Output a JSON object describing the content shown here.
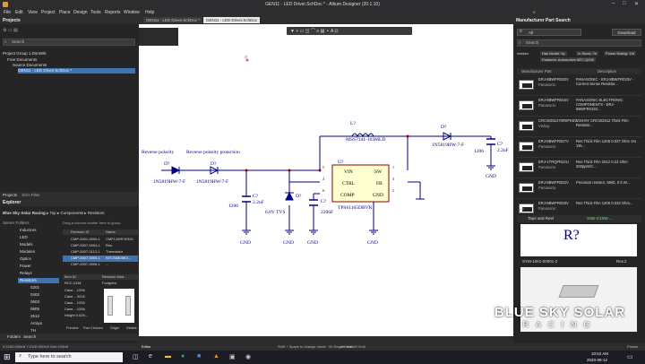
{
  "window": {
    "title": "GEN11 - LED Driver.SchDoc * - Altium Designer (20.1.10)",
    "menu": [
      "File",
      "Edit",
      "View",
      "Project",
      "Place",
      "Design",
      "Tools",
      "Reports",
      "Window",
      "Help"
    ],
    "search_placeholder": "Search"
  },
  "projects": {
    "title": "Projects",
    "search_placeholder": "Search",
    "tree": [
      {
        "label": "Project Group 1.DsnWrk"
      },
      {
        "label": "Free Documents"
      },
      {
        "label": "Source Documents"
      },
      {
        "label": "GEN11 - LED Driver.SchDoc *"
      }
    ],
    "bottom_tabs": [
      "Projects",
      "SCH Filter"
    ]
  },
  "explorer": {
    "title": "Explorer",
    "server": "Blue Sky Solar Racing",
    "crumbs": [
      "Top",
      "Components",
      "Resistors"
    ],
    "server_folders_label": "Server Folders",
    "folders": [
      "Inductors",
      "LED",
      "Models",
      "Modules",
      "Optics",
      "Power",
      "Relays",
      "Resistors",
      "0201",
      "0402",
      "0603",
      "0805",
      "2512",
      "Arrays",
      "TH",
      "Schdoc"
    ],
    "group_hint": "Drag a column header here to group",
    "columns": [
      "Revision ID",
      "Name"
    ],
    "rows": [
      [
        "CMP-0001-0000-1",
        "CMF120RFKR20"
      ],
      [
        "CMP-0007-0004-1",
        "Res"
      ],
      [
        "CMP-0007-0112-1",
        "Thermistor"
      ],
      [
        "CMP-0007-0005-1",
        "NTCS0805E3..."
      ],
      [
        "CMP-0007-0006-1",
        "..."
      ]
    ],
    "detail_label": "Item ID",
    "detail_revision": "Revision Mod...",
    "detail_item": "RCC-0161",
    "detail_footprint": "Footprint",
    "params": [
      {
        "name": "Case...",
        "value": "1206"
      },
      {
        "name": "Case...",
        "value": "3216"
      },
      {
        "name": "Case...",
        "value": "1206"
      },
      {
        "name": "Case...",
        "value": "1206"
      },
      {
        "name": "Height",
        "value": "0.026..."
      }
    ],
    "preview_tabs": [
      "Preview",
      "Part Choices",
      "Origin",
      "Details"
    ],
    "bottom_tabs": [
      "Folders",
      "Search"
    ]
  },
  "tabs": [
    "GEN11 - LED Driver.SchDoc *",
    "GEN11 - LED Driver.SchDoc"
  ],
  "schematic": {
    "labels": {
      "l7": "L?",
      "l7_part": "MSS7341-103MLD",
      "d7a": "D?",
      "d7b": "D?",
      "d7c": "D?",
      "d7d": "D?",
      "d_part": "1N5819HW-7-F",
      "d_part2": "1N5819HW-7-F",
      "d_part3": "1N5819HW-7-F",
      "tvs": "6.8V TVS",
      "c7a": "C?",
      "c7a_val": "2.2uF",
      "c7a_pkg": "1206",
      "c7b": "C?",
      "c7b_val": "220nF",
      "c7c": "C?",
      "c7c_val": "2.2uF",
      "c7c_pkg": "1206",
      "u7": "U?",
      "u7_part": "TPS61165DBVR",
      "pin_vin": "VIN",
      "pin_sw": "SW",
      "pin_ctrl": "CTRL",
      "pin_fb": "FB",
      "pin_comp": "COMP",
      "pin_gnd": "GND",
      "pin5": "5",
      "pin1": "1",
      "pin4": "4",
      "pin3": "3",
      "pin6": "6",
      "pin2": "2",
      "rev_a": "Reverse polarity",
      "rev_b": "Reverse polarity protection",
      "gnd": "GND",
      "j7": "J?"
    }
  },
  "part_search": {
    "title": "Manufacturer Part Search",
    "category": "All",
    "download": "Download",
    "search_placeholder": "Search",
    "filters": [
      "resistor",
      "Has Model: 5y",
      "In Stock: Ye",
      "Power Rating: 1W",
      "Features: Automotive AEC-Q200"
    ],
    "columns": [
      "Manufacturer Part",
      "Description"
    ],
    "results": [
      {
        "part": "ERJ-8BWFR020V",
        "mfr": "Panasonic",
        "desc": "PANASONIC - ERJ-8BWFR020V - Current Sense Resistor..."
      },
      {
        "part": "ERJ-8BWFR015V",
        "mfr": "Panasonic",
        "desc": "PANASONIC ELECTRONIC COMPONENTS - ERJ-8BWFR015V..."
      },
      {
        "part": "CRCW251270R0FKEG",
        "mfr": "Vishay",
        "desc": "VISHAY CRCW2512 Thick Film Resistor..."
      },
      {
        "part": "ERJ-8BWFR027V",
        "mfr": "Panasonic",
        "desc": "Res Thick Film 1206 0.027 Ohm 1% 1W..."
      },
      {
        "part": "ERJ-1TRQFR22U",
        "mfr": "Panasonic",
        "desc": "Res Thick Film 2512 0.22 Ohm 200ppm/C..."
      },
      {
        "part": "ERJ-8BWFR022V",
        "mfr": "Panasonic",
        "desc": "Precision resistor, SMD, 0.5 W..."
      },
      {
        "part": "ERJ-8BWFR033V",
        "mfr": "Panasonic",
        "desc": "Res Thick Film 1206 0.033 Ohm..."
      }
    ],
    "results_footer": "1-6",
    "tape_label": "Tape and Reel",
    "tape_value": "SSB-1/10W-..."
  },
  "right_part": {
    "symbol": "R?",
    "item": "SYM-1001-00001-2",
    "rev": "Rev.2"
  },
  "watermark": {
    "line1": "BLUE SKY SOLAR",
    "line2": "RACING"
  },
  "status": {
    "left": "X:1100.000mil Y:2100.000mil    Grid:100mil",
    "middle": "Shift + Space to change mode : 90 Degree start",
    "right": "dX:0mil dY:0mil",
    "editor": "Editor",
    "panels": "Panels"
  },
  "taskbar": {
    "search": "Type here to search",
    "time": "10:52 AM",
    "date": "2020-08-12"
  }
}
